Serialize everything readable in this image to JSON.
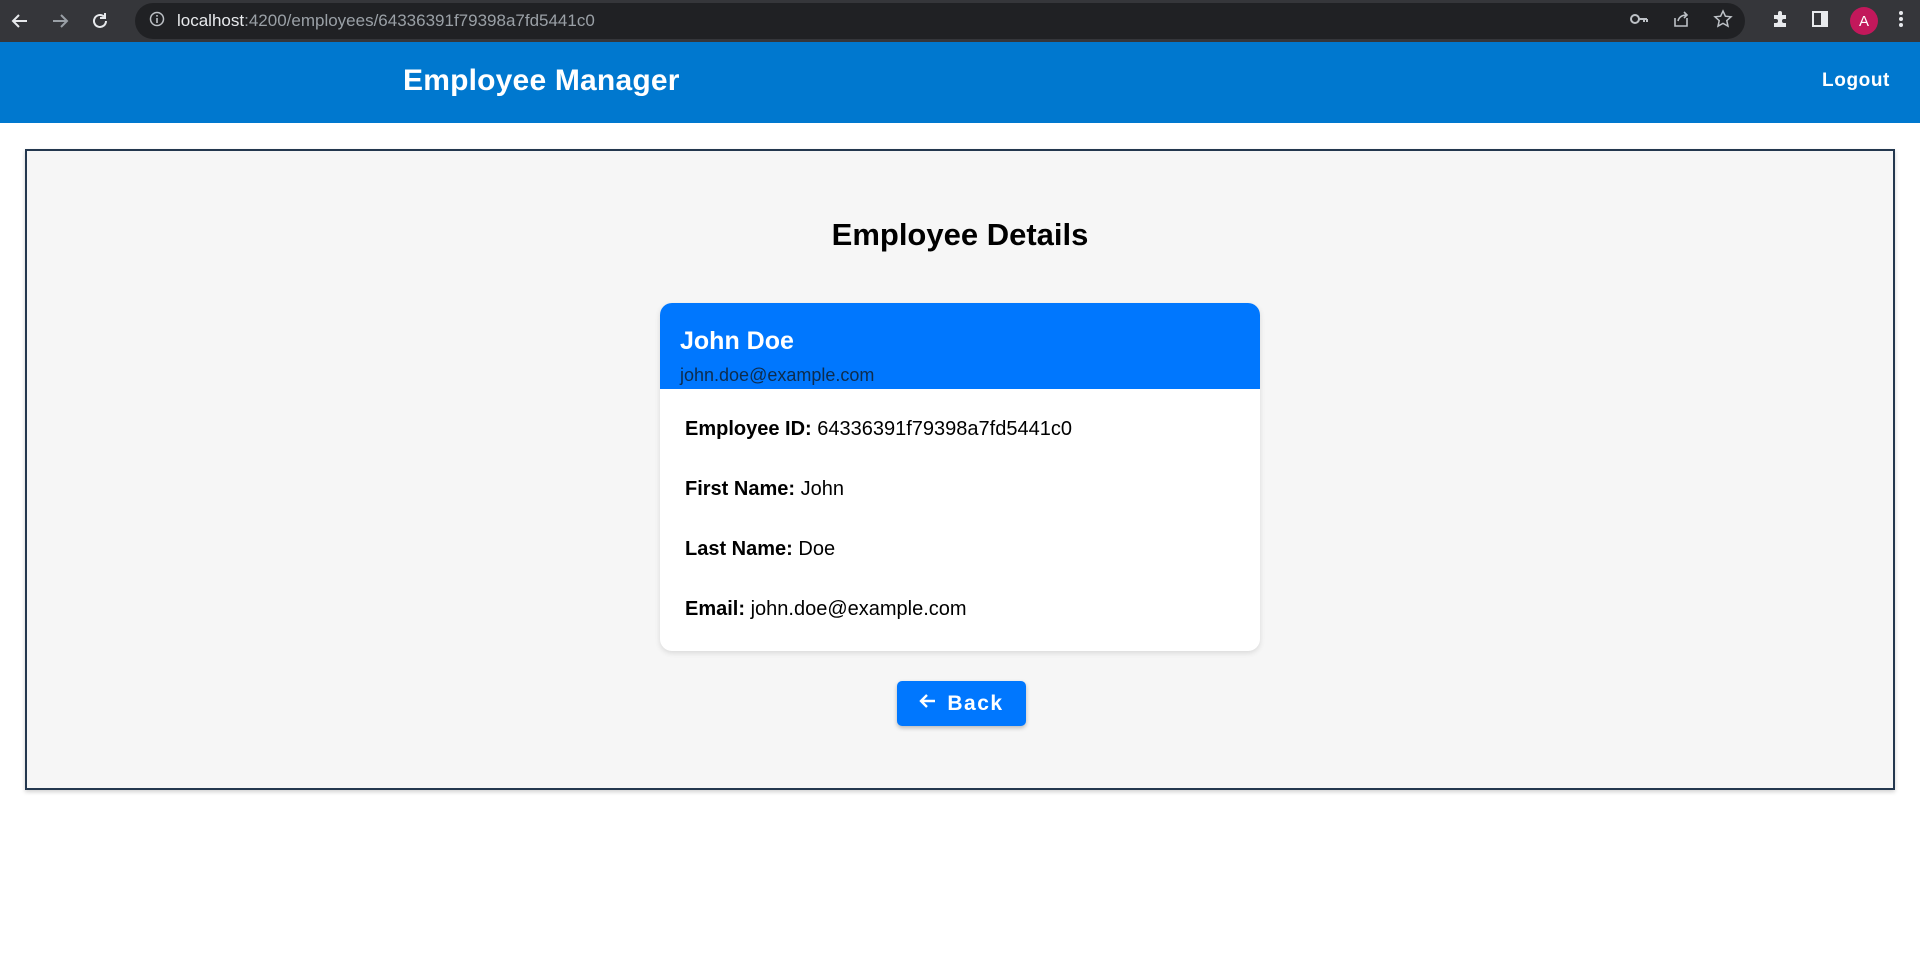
{
  "browser": {
    "url_host": "localhost",
    "url_rest": ":4200/employees/64336391f79398a7fd5441c0",
    "avatar_letter": "A",
    "icons": [
      "back-icon",
      "forward-icon",
      "reload-icon",
      "info-icon",
      "key-icon",
      "share-icon",
      "star-icon",
      "extensions-icon",
      "side-panel-icon",
      "menu-icon"
    ]
  },
  "header": {
    "title": "Employee Manager",
    "logout_label": "Logout",
    "color": "#0078cf"
  },
  "page": {
    "title": "Employee Details"
  },
  "card": {
    "name": "John Doe",
    "subtitle": "john.doe@example.com",
    "header_color": "#0077fe",
    "fields": [
      {
        "label": "Employee ID:",
        "value": "64336391f79398a7fd5441c0"
      },
      {
        "label": "First Name:",
        "value": "John"
      },
      {
        "label": "Last Name:",
        "value": "Doe"
      },
      {
        "label": "Email:",
        "value": "john.doe@example.com"
      }
    ]
  },
  "back_button": {
    "label": "Back",
    "icon": "arrow-left-icon"
  }
}
